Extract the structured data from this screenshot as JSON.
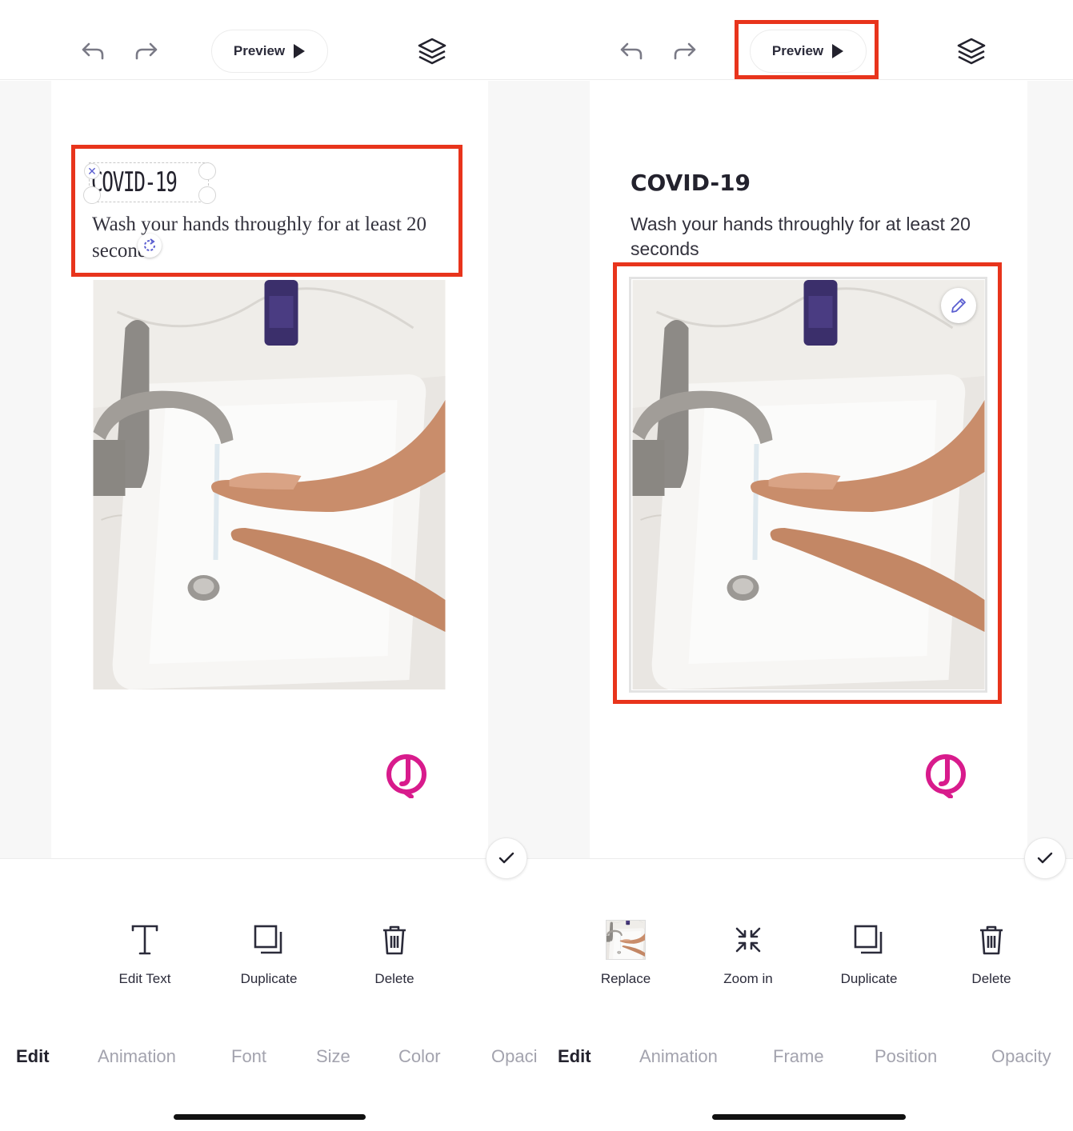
{
  "left": {
    "toolbar": {
      "preview_label": "Preview"
    },
    "text_block": {
      "title": "COVID-19",
      "body": "Wash your hands throughly for at least 20 seconds"
    },
    "actions": [
      {
        "label": "Edit Text",
        "icon": "text-t-icon"
      },
      {
        "label": "Duplicate",
        "icon": "duplicate-icon"
      },
      {
        "label": "Delete",
        "icon": "trash-icon"
      }
    ],
    "tabs": [
      "Edit",
      "Animation",
      "Font",
      "Size",
      "Color",
      "Opaci"
    ]
  },
  "right": {
    "toolbar": {
      "preview_label": "Preview"
    },
    "text_block": {
      "title": "COVID-19",
      "body": "Wash your hands throughly for at least 20 seconds"
    },
    "actions": [
      {
        "label": "Replace",
        "icon": "image-thumbnail"
      },
      {
        "label": "Zoom in",
        "icon": "zoom-in-arrows-icon"
      },
      {
        "label": "Duplicate",
        "icon": "duplicate-icon"
      },
      {
        "label": "Delete",
        "icon": "trash-icon"
      }
    ],
    "tabs": [
      "Edit",
      "Animation",
      "Frame",
      "Position",
      "Opacity"
    ]
  },
  "colors": {
    "highlight": "#e8341c",
    "logo": "#d81b8c",
    "active_tab": "#23222d",
    "inactive_tab": "#a3a3ae"
  }
}
